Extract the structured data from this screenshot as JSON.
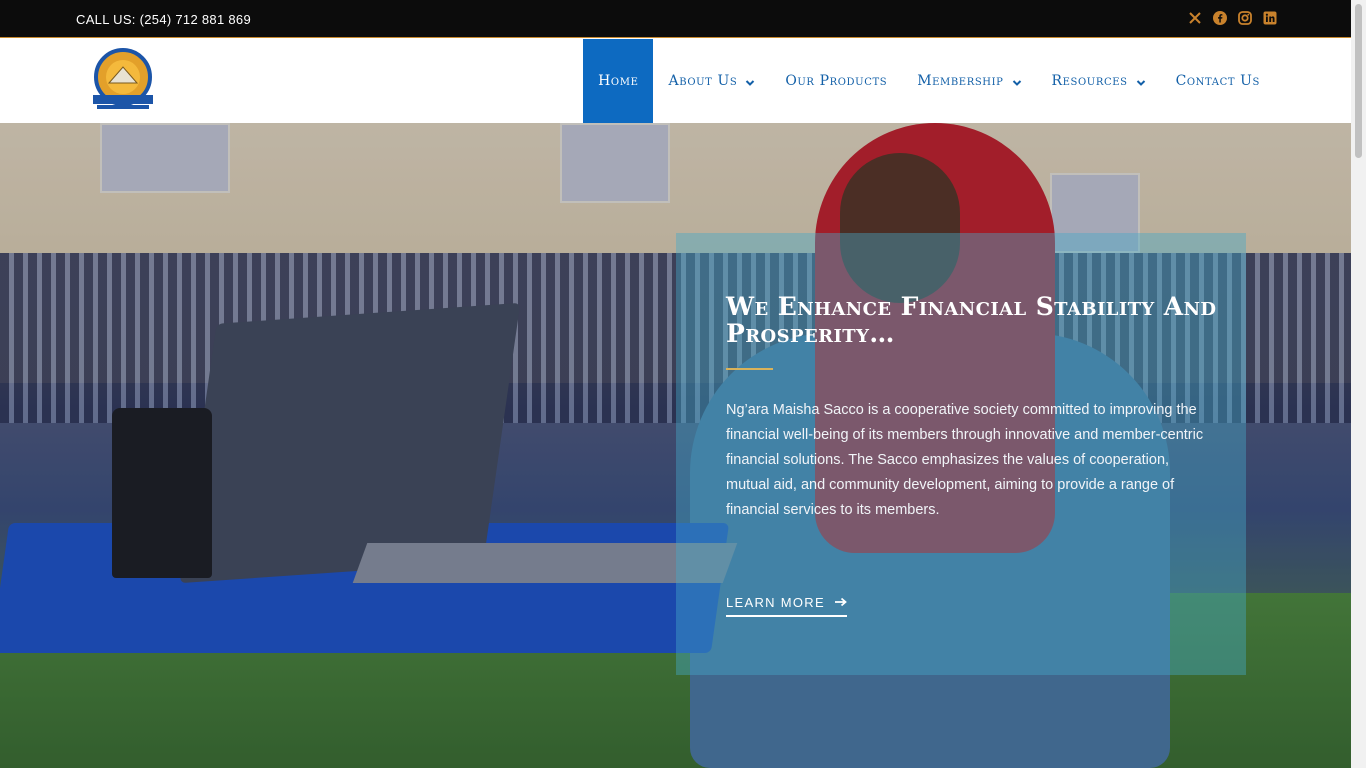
{
  "topbar": {
    "call_text": "CALL US: (254) 712 881 869",
    "socials": [
      "x-icon",
      "facebook-icon",
      "instagram-icon",
      "linkedin-icon"
    ],
    "social_color": "#c9822c"
  },
  "header": {
    "logo_alt": "N.M. SACCO",
    "logo_text_top": "NGARA MAISHA SACCO",
    "logo_text_mid": "N.M. SACCO",
    "nav": [
      {
        "label": "Home",
        "active": true,
        "has_dropdown": false
      },
      {
        "label": "About Us",
        "active": false,
        "has_dropdown": true
      },
      {
        "label": "Our Products",
        "active": false,
        "has_dropdown": false
      },
      {
        "label": "Membership",
        "active": false,
        "has_dropdown": true
      },
      {
        "label": "Resources",
        "active": false,
        "has_dropdown": true
      },
      {
        "label": "Contact Us",
        "active": false,
        "has_dropdown": false
      }
    ],
    "accent": "#0d6ac1"
  },
  "hero": {
    "heading": "We Enhance Financial Stability And Prosperity…",
    "body": "Ng’ara Maisha Sacco is a cooperative society committed to improving the financial well-being of its members through innovative and member-centric financial solutions. The Sacco emphasizes the values of cooperation, mutual aid, and community development, aiming to provide a range of financial services to its members.",
    "cta": "LEARN MORE",
    "cta_icon": "arrow-right-icon"
  }
}
